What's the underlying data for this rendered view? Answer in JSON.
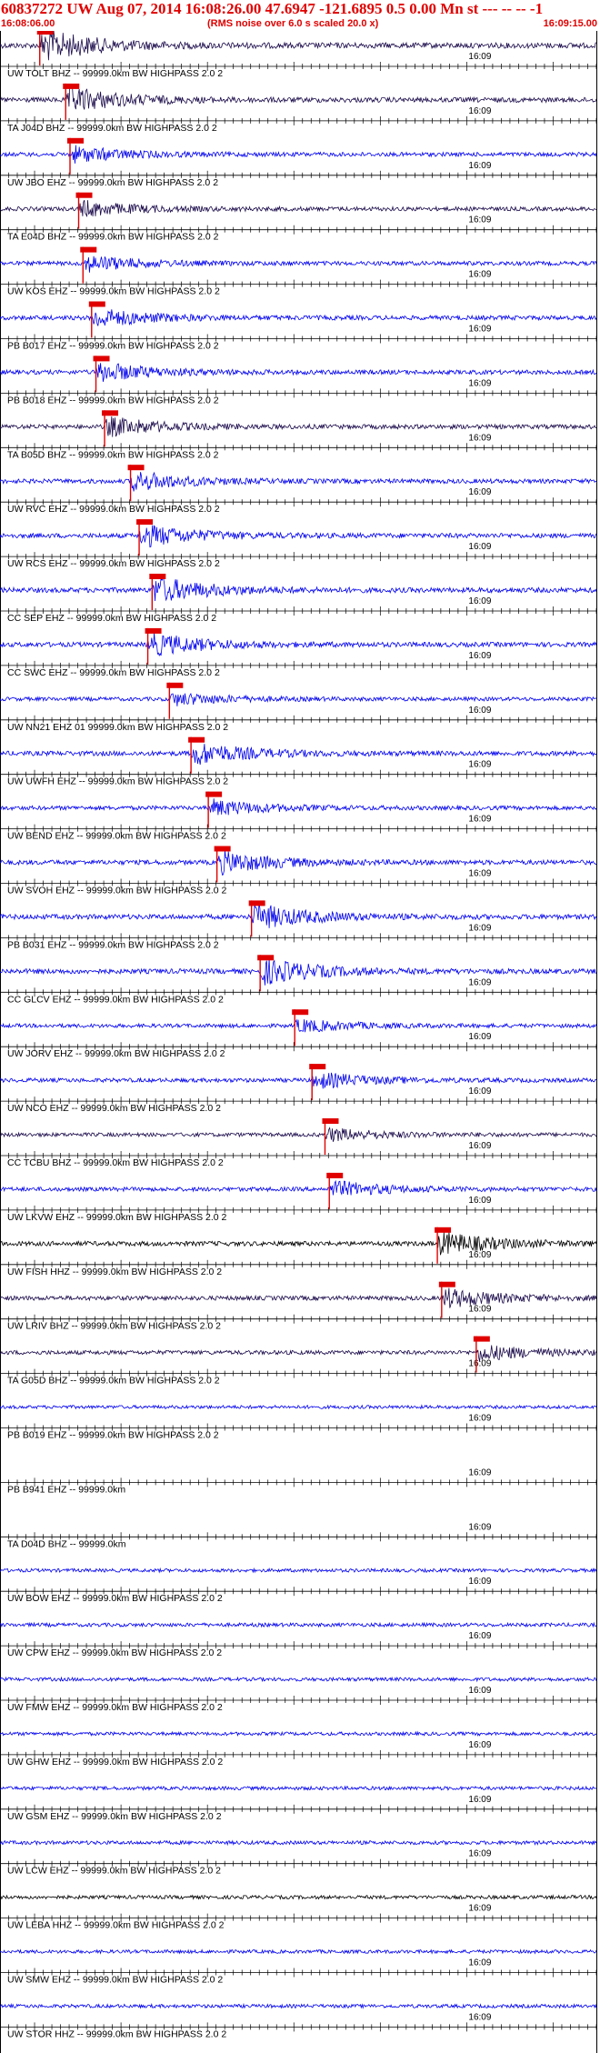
{
  "header": {
    "title": "60837272 UW Aug 07, 2014 16:08:26.00   47.6947 -121.6895  0.5 0.00 Mn st --- -- --  -1",
    "start_time": "16:08:06.00",
    "note": "(RMS noise over 6.0 s scaled 20.0 x)",
    "end_time": "16:09:15.00"
  },
  "colors": {
    "header_text": "#e00000",
    "pick": "#e00000",
    "blue": "#0000ee",
    "dark": "#1a0a4a",
    "black": "#000000",
    "axis": "#000000"
  },
  "chart_data": {
    "type": "line",
    "title": "60837272 UW Aug 07, 2014 16:08:26.00   47.6947 -121.6895  0.5 0.00 Mn st --- -- --  -1",
    "x_range": [
      "16:08:06.00",
      "16:09:15.00"
    ],
    "minute_tick_label": "16:09",
    "traces": [
      {
        "label": "UW TOLT BHZ -- 99999.0km BW  HIGHPASS  2.0  2",
        "color": "dark",
        "pick": "16:08:10.6",
        "amp": 1.0
      },
      {
        "label": "TA J04D BHZ -- 99999.0km BW  HIGHPASS  2.0  2",
        "color": "dark",
        "pick": "16:08:13.6",
        "amp": 0.8
      },
      {
        "label": "UW JBO EHZ -- 99999.0km BW  HIGHPASS  2.0  2",
        "color": "blue",
        "pick": "16:08:14.1",
        "amp": 0.5
      },
      {
        "label": "TA E04D BHZ -- 99999.0km BW  HIGHPASS  2.0  2",
        "color": "dark",
        "pick": "16:08:15.1",
        "amp": 0.5
      },
      {
        "label": "UW KOS EHZ -- 99999.0km BW  HIGHPASS  2.0  2",
        "color": "blue",
        "pick": "16:08:15.6",
        "amp": 0.5
      },
      {
        "label": "PB B017 EHZ -- 99999.0km BW  HIGHPASS  2.0  2",
        "color": "blue",
        "pick": "16:08:16.6",
        "amp": 0.6
      },
      {
        "label": "PB B018 EHZ -- 99999.0km BW  HIGHPASS  2.0  2",
        "color": "blue",
        "pick": "16:08:17.1",
        "amp": 0.6
      },
      {
        "label": "TA B05D BHZ -- 99999.0km BW  HIGHPASS  2.0  2",
        "color": "dark",
        "pick": "16:08:18.1",
        "amp": 0.6
      },
      {
        "label": "UW RVC EHZ -- 99999.0km BW  HIGHPASS  2.0  2",
        "color": "blue",
        "pick": "16:08:21.1",
        "amp": 0.6
      },
      {
        "label": "UW RCS EHZ -- 99999.0km BW  HIGHPASS  2.0  2",
        "color": "blue",
        "pick": "16:08:22.1",
        "amp": 0.7
      },
      {
        "label": "CC SEP EHZ -- 99999.0km BW  HIGHPASS  2.0  2",
        "color": "blue",
        "pick": "16:08:23.6",
        "amp": 0.8
      },
      {
        "label": "CC SWC EHZ -- 99999.0km BW  HIGHPASS  2.0  2",
        "color": "blue",
        "pick": "16:08:23.1",
        "amp": 0.7
      },
      {
        "label": "UW NN21 EHZ 01 99999.0km BW  HIGHPASS  2.0  2",
        "color": "blue",
        "pick": "16:08:25.6",
        "amp": 0.4
      },
      {
        "label": "UW UWFH EHZ -- 99999.0km BW  HIGHPASS  2.0  2",
        "color": "blue",
        "pick": "16:08:28.1",
        "amp": 0.7
      },
      {
        "label": "UW BEND EHZ -- 99999.0km BW  HIGHPASS  2.0  2",
        "color": "blue",
        "pick": "16:08:30.1",
        "amp": 0.5
      },
      {
        "label": "UW SVOH EHZ -- 99999.0km BW  HIGHPASS  2.0  2",
        "color": "blue",
        "pick": "16:08:31.1",
        "amp": 0.7
      },
      {
        "label": "PB B031 EHZ -- 99999.0km BW  HIGHPASS  2.0  2",
        "color": "blue",
        "pick": "16:08:35.1",
        "amp": 0.8
      },
      {
        "label": "CC GLCV EHZ -- 99999.0km BW  HIGHPASS  2.0  2",
        "color": "blue",
        "pick": "16:08:36.1",
        "amp": 0.8
      },
      {
        "label": "UW JORV EHZ -- 99999.0km BW  HIGHPASS  2.0  2",
        "color": "blue",
        "pick": "16:08:40.1",
        "amp": 0.4
      },
      {
        "label": "UW NCO EHZ -- 99999.0km BW  HIGHPASS  2.0  2",
        "color": "blue",
        "pick": "16:08:42.1",
        "amp": 0.5
      },
      {
        "label": "CC TCBU BHZ -- 99999.0km BW  HIGHPASS  2.0  2",
        "color": "dark",
        "pick": "16:08:43.6",
        "amp": 0.4
      },
      {
        "label": "UW LKVW EHZ -- 99999.0km BW  HIGHPASS  2.0  2",
        "color": "blue",
        "pick": "16:08:44.1",
        "amp": 0.5
      },
      {
        "label": "UW FISH HHZ -- 99999.0km BW  HIGHPASS  2.0  2",
        "color": "black",
        "pick": "16:08:56.6",
        "amp": 0.7
      },
      {
        "label": "UW LRIV BHZ -- 99999.0km BW  HIGHPASS  2.0  2",
        "color": "dark",
        "pick": "16:08:57.1",
        "amp": 0.6
      },
      {
        "label": "TA G05D BHZ -- 99999.0km BW  HIGHPASS  2.0  2",
        "color": "dark",
        "pick": "16:09:01.1",
        "amp": 0.5
      },
      {
        "label": "PB B019 EHZ -- 99999.0km BW  HIGHPASS  2.0  2",
        "color": "blue",
        "pick": null,
        "amp": 0.2
      },
      {
        "label": "PB B941 EHZ -- 99999.0km",
        "color": "blue",
        "pick": null,
        "amp": 0
      },
      {
        "label": "TA D04D BHZ -- 99999.0km",
        "color": "blue",
        "pick": null,
        "amp": 0
      },
      {
        "label": "UW BOW EHZ -- 99999.0km BW  HIGHPASS  2.0  2",
        "color": "blue",
        "pick": null,
        "amp": 0.25
      },
      {
        "label": "UW CPW EHZ -- 99999.0km BW  HIGHPASS  2.0  2",
        "color": "blue",
        "pick": null,
        "amp": 0.35
      },
      {
        "label": "UW FMW EHZ -- 99999.0km BW  HIGHPASS  2.0  2",
        "color": "blue",
        "pick": null,
        "amp": 0.3
      },
      {
        "label": "UW GHW EHZ -- 99999.0km BW  HIGHPASS  2.0  2",
        "color": "blue",
        "pick": null,
        "amp": 0.25
      },
      {
        "label": "UW GSM EHZ -- 99999.0km BW  HIGHPASS  2.0  2",
        "color": "blue",
        "pick": null,
        "amp": 0.3
      },
      {
        "label": "UW LCW EHZ -- 99999.0km BW  HIGHPASS  2.0  2",
        "color": "blue",
        "pick": null,
        "amp": 0.35
      },
      {
        "label": "UW LEBA HHZ -- 99999.0km BW  HIGHPASS  2.0  2",
        "color": "black",
        "pick": null,
        "amp": 0.3
      },
      {
        "label": "UW SMW EHZ -- 99999.0km BW  HIGHPASS  2.0  2",
        "color": "blue",
        "pick": null,
        "amp": 0.25
      },
      {
        "label": "UW STOR HHZ -- 99999.0km BW  HIGHPASS  2.0  2",
        "color": "blue",
        "pick": null,
        "amp": 0.3
      }
    ]
  }
}
